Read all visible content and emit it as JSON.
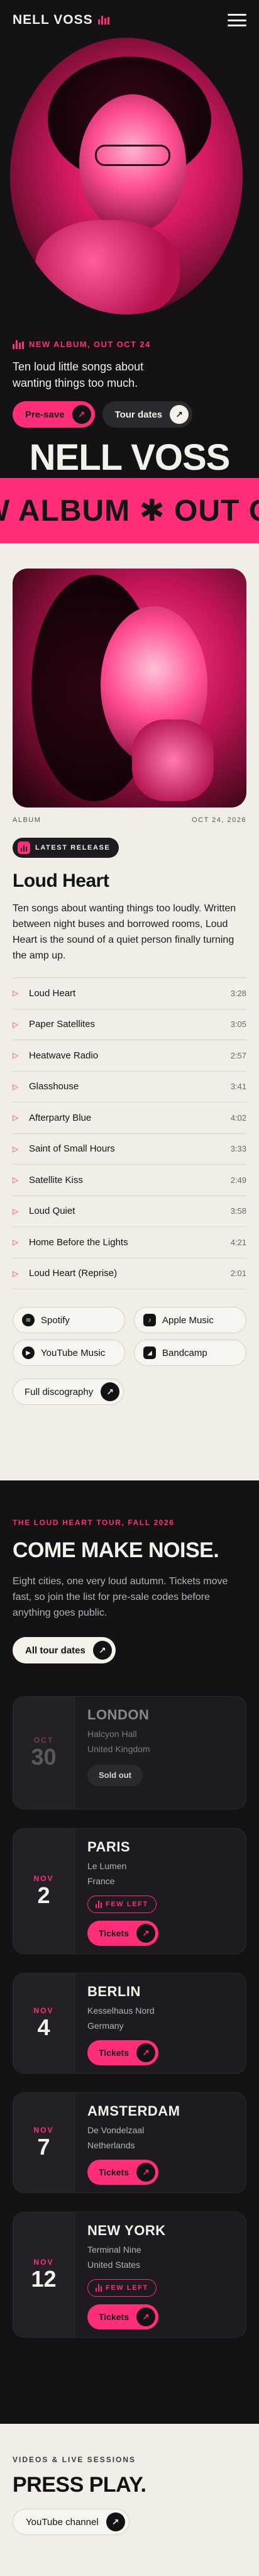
{
  "header": {
    "logo": "NELL VOSS",
    "menu_icon": "hamburger-menu-icon"
  },
  "hero": {
    "eyebrow": "NEW ALBUM, OUT OCT 24",
    "tagline": "Ten loud little songs about wanting things too much.",
    "presave_label": "Pre-save",
    "tour_label": "Tour dates",
    "name": "NELL VOSS"
  },
  "marquee": {
    "text": "W ALBUM  ✱  OUT OCT"
  },
  "release": {
    "meta_left": "ALBUM",
    "meta_right": "OCT 24, 2026",
    "badge": "LATEST RELEASE",
    "title": "Loud Heart",
    "description": "Ten songs about wanting things too loudly. Written between night buses and borrowed rooms, Loud Heart is the sound of a quiet person finally turning the amp up.",
    "tracks": [
      {
        "title": "Loud Heart",
        "duration": "3:28"
      },
      {
        "title": "Paper Satellites",
        "duration": "3:05"
      },
      {
        "title": "Heatwave Radio",
        "duration": "2:57"
      },
      {
        "title": "Glasshouse",
        "duration": "3:41"
      },
      {
        "title": "Afterparty Blue",
        "duration": "4:02"
      },
      {
        "title": "Saint of Small Hours",
        "duration": "3:33"
      },
      {
        "title": "Satellite Kiss",
        "duration": "2:49"
      },
      {
        "title": "Loud Quiet",
        "duration": "3:58"
      },
      {
        "title": "Home Before the Lights",
        "duration": "4:21"
      },
      {
        "title": "Loud Heart (Reprise)",
        "duration": "2:01"
      }
    ],
    "platforms": [
      {
        "label": "Spotify",
        "icon": "spotify-icon"
      },
      {
        "label": "Apple Music",
        "icon": "apple-music-icon"
      },
      {
        "label": "YouTube Music",
        "icon": "youtube-music-icon"
      },
      {
        "label": "Bandcamp",
        "icon": "bandcamp-icon"
      }
    ],
    "discography_label": "Full discography"
  },
  "tour": {
    "eyebrow": "THE LOUD HEART TOUR, FALL 2026",
    "title": "COME MAKE NOISE.",
    "description": "Eight cities, one very loud autumn. Tickets move fast, so join the list for pre-sale codes before anything goes public.",
    "all_dates_label": "All tour dates",
    "shows": [
      {
        "month": "OCT",
        "day": "30",
        "city": "LONDON",
        "venue": "Halcyon Hall",
        "country": "United Kingdom",
        "status": "Sold out"
      },
      {
        "month": "NOV",
        "day": "2",
        "city": "PARIS",
        "venue": "Le Lumen",
        "country": "France",
        "status": "FEW LEFT",
        "cta": "Tickets"
      },
      {
        "month": "NOV",
        "day": "4",
        "city": "BERLIN",
        "venue": "Kesselhaus Nord",
        "country": "Germany",
        "cta": "Tickets"
      },
      {
        "month": "NOV",
        "day": "7",
        "city": "AMSTERDAM",
        "venue": "De Vondelzaal",
        "country": "Netherlands",
        "cta": "Tickets"
      },
      {
        "month": "NOV",
        "day": "12",
        "city": "NEW YORK",
        "venue": "Terminal Nine",
        "country": "United States",
        "status": "FEW LEFT",
        "cta": "Tickets"
      }
    ]
  },
  "video": {
    "eyebrow": "VIDEOS & LIVE SESSIONS",
    "title": "PRESS PLAY.",
    "youtube_label": "YouTube channel"
  },
  "colors": {
    "accent": "#ff2d7a",
    "dark": "#141215",
    "cream": "#f1eee7"
  }
}
